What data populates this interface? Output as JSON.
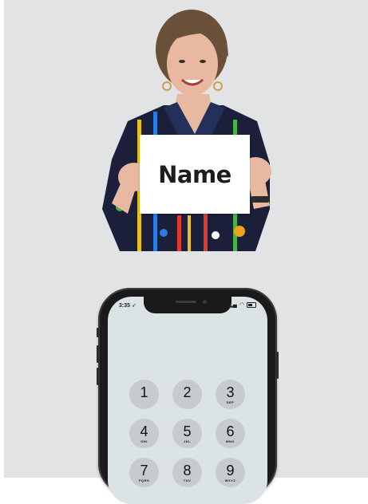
{
  "sign": {
    "text": "Name"
  },
  "phone": {
    "status_time": "3:35",
    "keypad": [
      {
        "digit": "1",
        "letters": ""
      },
      {
        "digit": "2",
        "letters": ""
      },
      {
        "digit": "3",
        "letters": "DEF"
      },
      {
        "digit": "4",
        "letters": "GHI"
      },
      {
        "digit": "5",
        "letters": "JKL"
      },
      {
        "digit": "6",
        "letters": "MNO"
      },
      {
        "digit": "7",
        "letters": "PQRS"
      },
      {
        "digit": "8",
        "letters": "TUV"
      },
      {
        "digit": "9",
        "letters": "WXYZ"
      }
    ]
  },
  "colors": {
    "background": "#e2e3e5",
    "hair": "#6a5038",
    "skin": "#e8b9a0",
    "shirt": "#1b1f3a"
  }
}
